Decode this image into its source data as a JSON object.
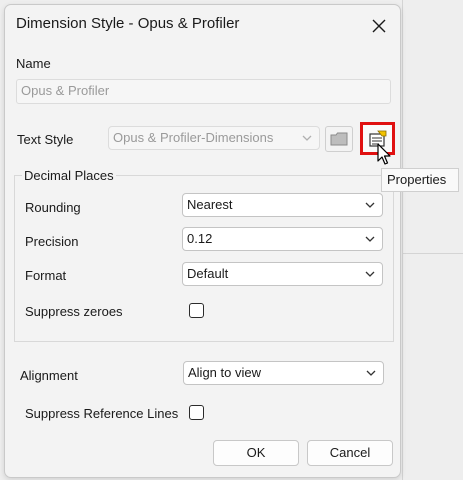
{
  "dialog": {
    "title": "Dimension Style - Opus & Profiler",
    "name_label": "Name",
    "name_value": "Opus & Profiler",
    "text_style_label": "Text Style",
    "text_style_value": "Opus & Profiler-Dimensions",
    "decimal_group_label": "Decimal Places",
    "rounding_label": "Rounding",
    "rounding_value": "Nearest",
    "precision_label": "Precision",
    "precision_value": "0.12",
    "format_label": "Format",
    "format_value": "Default",
    "suppress_zeroes_label": "Suppress zeroes",
    "suppress_zeroes_checked": false,
    "alignment_label": "Alignment",
    "alignment_value": "Align to view",
    "suppress_ref_lines_label": "Suppress Reference Lines",
    "suppress_ref_lines_checked": false,
    "ok_label": "OK",
    "cancel_label": "Cancel"
  },
  "tooltip": {
    "text": "Properties"
  },
  "icons": {
    "close": "close-icon",
    "folder": "folder-icon",
    "properties": "properties-icon",
    "chevron": "chevron-down-icon",
    "cursor": "mouse-pointer-icon"
  },
  "colors": {
    "highlight": "#e01010",
    "accent_yellow": "#f2c200"
  }
}
